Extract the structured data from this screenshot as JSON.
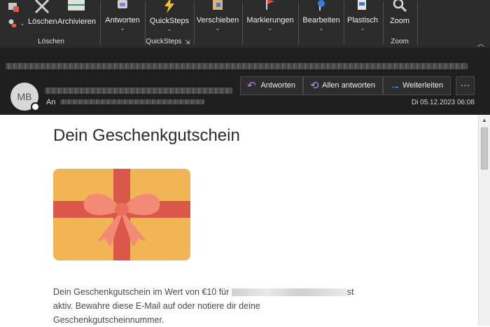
{
  "ribbon": {
    "delete_label": "Löschen",
    "archive_label": "Archivieren",
    "delete_group": "Löschen",
    "reply_label": "Antworten",
    "quicksteps_label": "QuickSteps",
    "quicksteps_group": "QuickSteps",
    "move_label": "Verschieben",
    "tags_label": "Markierungen",
    "edit_label": "Bearbeiten",
    "immersive_label": "Plastisch",
    "zoom_label": "Zoom",
    "zoom_group": "Zoom"
  },
  "header": {
    "avatar_initials": "MB",
    "to_label": "An",
    "reply_button": "Antworten",
    "reply_all_button": "Allen antworten",
    "forward_button": "Weiterleiten",
    "more_button": "···",
    "date": "Di 05.12.2023 06:08"
  },
  "email": {
    "subject": "Dein Geschenkgutschein",
    "body_start": "Dein Geschenkgutschein im Wert von €10 für ",
    "body_end": "st aktiv. Bewahre diese E-Mail auf oder notiere dir deine Geschenkgutscheinnummer."
  },
  "colors": {
    "ribbon_bg": "#2b2b2b",
    "header_bg": "#1f1f1f",
    "gift_card": "#f1b556",
    "gift_ribbon": "#d9584a",
    "gift_bow": "#f38a76",
    "reply_arrow": "#b28cf0",
    "forward_arrow": "#4ea3f0"
  }
}
